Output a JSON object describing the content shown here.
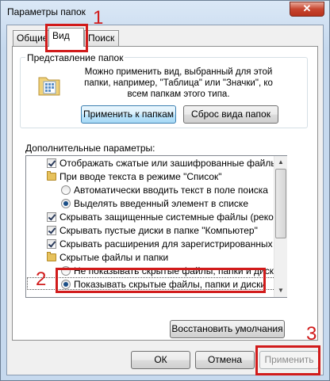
{
  "window": {
    "title": "Параметры папок",
    "close_glyph": "✕"
  },
  "tabs": [
    {
      "label": "Общие"
    },
    {
      "label": "Вид"
    },
    {
      "label": "Поиск"
    }
  ],
  "folder_views": {
    "legend": "Представление папок",
    "description": "Можно применить вид, выбранный для этой папки, например, \"Таблица\" или \"Значки\", ко всем папкам этого типа.",
    "apply_button": "Применить к папкам",
    "reset_button": "Сброс вида папок"
  },
  "advanced": {
    "label": "Дополнительные параметры:",
    "items": [
      {
        "type": "checkbox",
        "checked": true,
        "text": "Отображать сжатые или зашифрованные файлы NTI"
      },
      {
        "type": "folder",
        "text": "При вводе текста в режиме \"Список\""
      },
      {
        "type": "radio",
        "checked": false,
        "text": "Автоматически вводить текст в поле поиска"
      },
      {
        "type": "radio",
        "checked": true,
        "text": "Выделять введенный элемент в списке"
      },
      {
        "type": "checkbox",
        "checked": true,
        "text": "Скрывать защищенные системные файлы (рекомен"
      },
      {
        "type": "checkbox",
        "checked": true,
        "text": "Скрывать пустые диски в папке \"Компьютер\""
      },
      {
        "type": "checkbox",
        "checked": true,
        "text": "Скрывать расширения для зарегистрированных типо"
      },
      {
        "type": "folder",
        "text": "Скрытые файлы и папки"
      },
      {
        "type": "radio",
        "checked": false,
        "text": "Не показывать скрытые файлы, папки и диски"
      },
      {
        "type": "radio",
        "checked": true,
        "text": "Показывать скрытые файлы, папки и диски"
      }
    ]
  },
  "restore_button": "Восстановить умолчания",
  "footer": {
    "ok": "ОК",
    "cancel": "Отмена",
    "apply": "Применить"
  },
  "annotations": [
    "1",
    "2",
    "3"
  ],
  "colors": {
    "annotation": "#d11b1b",
    "accent": "#3c7fb1"
  }
}
